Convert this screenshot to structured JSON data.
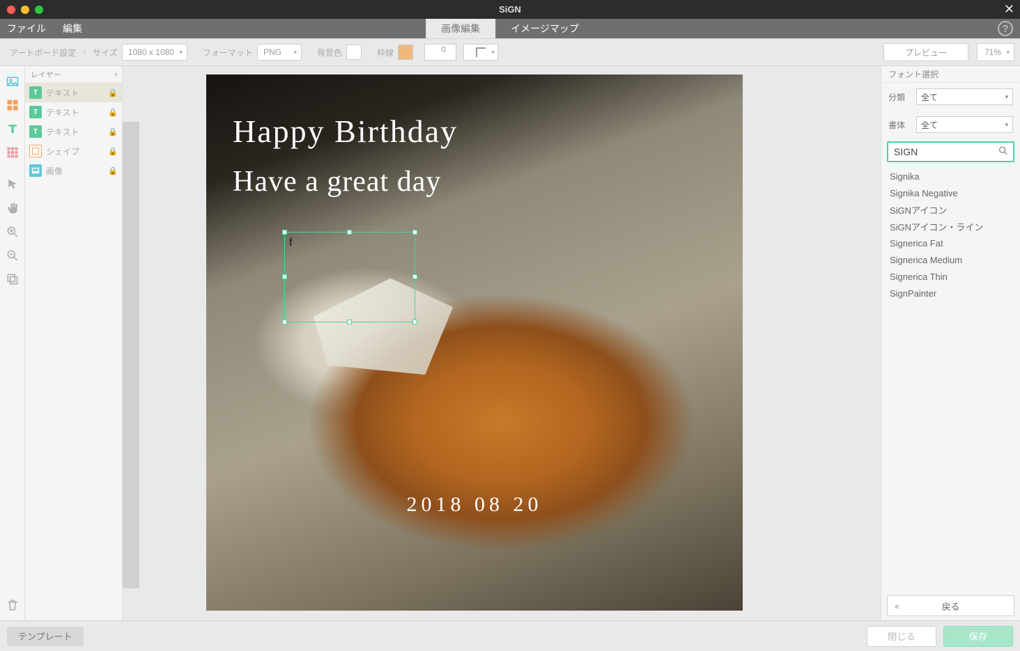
{
  "titlebar": {
    "title": "SiGN"
  },
  "menubar": {
    "file": "ファイル",
    "edit": "編集"
  },
  "tabs": {
    "image_edit": "画像編集",
    "image_map": "イメージマップ"
  },
  "toolbar": {
    "artboard_settings": "アートボード設定",
    "size_label": "サイズ",
    "size_value": "1080 x 1080",
    "format_label": "フォーマット",
    "format_value": "PNG",
    "bgcolor_label": "背景色",
    "border_label": "枠線",
    "border_num": "0",
    "preview": "プレビュー",
    "zoom": "71%"
  },
  "layers": {
    "header": "レイヤー",
    "items": [
      {
        "label": "テキスト",
        "type": "text",
        "selected": true
      },
      {
        "label": "テキスト",
        "type": "text"
      },
      {
        "label": "テキスト",
        "type": "text"
      },
      {
        "label": "シェイプ",
        "type": "shape"
      },
      {
        "label": "画像",
        "type": "image"
      }
    ]
  },
  "canvas": {
    "text1": "Happy Birthday",
    "text2": "Have a great day",
    "text3": "2018 08 20",
    "selection_text": "f"
  },
  "font_panel": {
    "header": "フォント選択",
    "category_label": "分類",
    "category_value": "全て",
    "weight_label": "書体",
    "weight_value": "全て",
    "search_value": "SIGN",
    "results": [
      "Signika",
      "Signika Negative",
      "SiGNアイコン",
      "SiGNアイコン・ライン",
      "Signerica Fat",
      "Signerica Medium",
      "Signerica Thin",
      "SignPainter"
    ],
    "back": "戻る"
  },
  "footer": {
    "template": "テンプレート",
    "close": "閉じる",
    "save": "保存"
  }
}
